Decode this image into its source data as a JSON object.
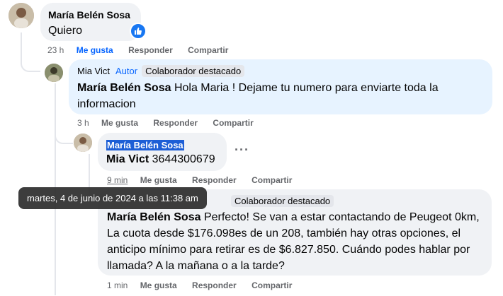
{
  "comments": [
    {
      "author": "María Belén Sosa",
      "text": "Quiero",
      "time": "23 h",
      "like_label": "Me gusta",
      "reply_label": "Responder",
      "share_label": "Compartir"
    },
    {
      "author": "Mia Vict",
      "author_badge": "Autor",
      "role_badge": "Colaborador destacado",
      "mention": "María Belén Sosa",
      "text": "Hola Maria ! Dejame tu numero para enviarte toda la informacion",
      "time": "3 h",
      "like_label": "Me gusta",
      "reply_label": "Responder",
      "share_label": "Compartir"
    },
    {
      "author": "María Belén Sosa",
      "mention": "Mia Vict",
      "text": "3644300679",
      "time": "9 min",
      "like_label": "Me gusta",
      "reply_label": "Responder",
      "share_label": "Compartir"
    },
    {
      "role_badge": "Colaborador destacado",
      "mention": "María Belén Sosa",
      "text": "Perfecto! Se van a estar contactando de Peugeot 0km, La cuota desde $176.098es de un 208, también hay otras opciones, el anticipo mínimo para retirar es de $6.827.850. Cuándo podes hablar por llamada? A la mañana o a la tarde?",
      "time": "1 min",
      "like_label": "Me gusta",
      "reply_label": "Responder",
      "share_label": "Compartir"
    }
  ],
  "tooltip": "martes, 4 de junio de 2024 a las 11:38 am",
  "more_icon": "ellipsis-icon",
  "colors": {
    "bubble": "#f0f2f5",
    "bubble_highlight": "#e7f3ff",
    "link_blue": "#0866ff",
    "meta_gray": "#65676b"
  }
}
